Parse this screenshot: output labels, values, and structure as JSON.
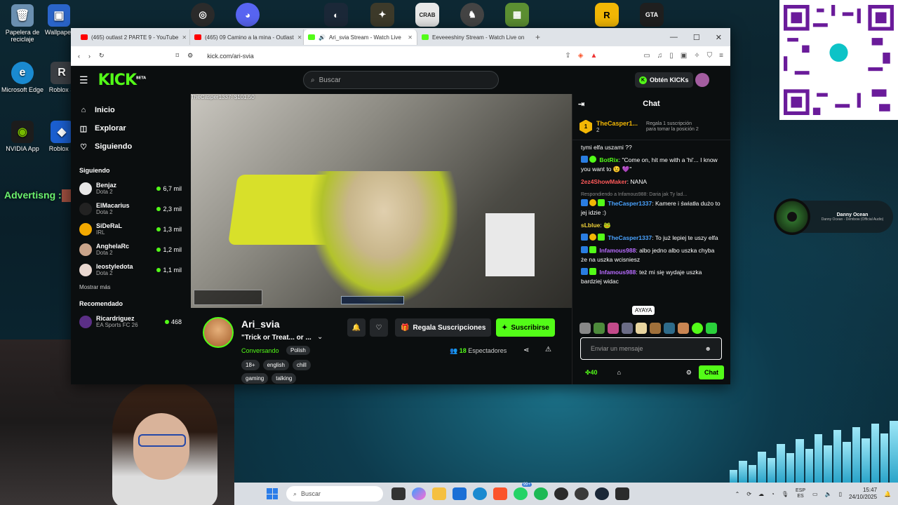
{
  "desktop": {
    "icons": [
      {
        "label": "Papelera de reciclaje",
        "glyph": "🗑",
        "color": "#6a8fb0"
      },
      {
        "label": "Wallpaper",
        "glyph": "▣",
        "color": "#2a64c9"
      },
      {
        "label": "Microsoft Edge",
        "glyph": "e",
        "color": "#1a8ad0"
      },
      {
        "label": "Roblox S",
        "glyph": "R",
        "color": "#3b3f44"
      },
      {
        "label": "NVIDIA App",
        "glyph": "◉",
        "color": "#76b900"
      },
      {
        "label": "Roblox P",
        "glyph": "◆",
        "color": "#1b5fd0"
      }
    ],
    "advertising": "Advertisng :"
  },
  "music": {
    "title": "Danny Ocean",
    "subtitle": "Danny Ocean - Dembow (Official Audio)"
  },
  "browser": {
    "tabs": [
      {
        "label": "(465) outlast 2 PARTE 9 - YouTube",
        "color": "#ff0000"
      },
      {
        "label": "(465) 09 Camino a la mina - Outlast",
        "color": "#ff0000"
      },
      {
        "label": "Ari_svia Stream - Watch Live",
        "color": "#53fc18"
      },
      {
        "label": "Eeveeeshiny Stream - Watch Live on",
        "color": "#53fc18"
      }
    ],
    "url": "kick.com/ari-svia",
    "newtab": "+",
    "min": "—",
    "max": "☐",
    "close": "✕"
  },
  "kick": {
    "logo": "KICK",
    "logo_beta": "BETA",
    "search_placeholder": "Buscar",
    "get_kicks": "Obtén KICKs",
    "nav": [
      {
        "label": "Inicio",
        "icon": "⌂"
      },
      {
        "label": "Explorar",
        "icon": "◫"
      },
      {
        "label": "Siguiendo",
        "icon": "♡"
      }
    ],
    "following_heading": "Siguiendo",
    "following": [
      {
        "name": "Benjaz",
        "category": "Dota 2",
        "viewers": "6,7 mil",
        "color": "#e8e8e8"
      },
      {
        "name": "ElMacarius",
        "category": "Dota 2",
        "viewers": "2,3 mil",
        "color": "#222222"
      },
      {
        "name": "SiDeRaL",
        "category": "IRL",
        "viewers": "1,3 mil",
        "color": "#f2a900"
      },
      {
        "name": "AnghelaRc",
        "category": "Dota 2",
        "viewers": "1,2 mil",
        "color": "#c9a48a"
      },
      {
        "name": "leostyledota",
        "category": "Dota 2",
        "viewers": "1,1 mil",
        "color": "#e9d8d0"
      }
    ],
    "show_more": "Mostrar más",
    "recommended_heading": "Recomendado",
    "recommended": [
      {
        "name": "Ricardriguez",
        "category": "EA Sports FC 26",
        "viewers": "468",
        "color": "#5b2f86"
      }
    ],
    "donor_overlay": "TheCasper1337: $101.50",
    "stream": {
      "name": "Ari_svia",
      "title": "\"Trick or Treat... or ...",
      "category": "Conversando",
      "language": "Polish",
      "tags": [
        "18+",
        "english",
        "chill",
        "gaming",
        "talking"
      ],
      "gift_label": "Regala Suscripciones",
      "subscribe_label": "Suscribirse",
      "viewers_count": "18",
      "viewers_label": "Espectadores"
    },
    "chat": {
      "title": "Chat",
      "pinned": {
        "rank": "1",
        "name": "TheCasper1...",
        "count": "2",
        "gift_text": "Regala 1 suscripción para tomar la posición 2"
      },
      "messages": [
        {
          "user": "",
          "color": "#ffffff",
          "text": "tymi elfa uszami ??",
          "reply": ""
        },
        {
          "user": "BotRix",
          "color": "#53fc18",
          "text": "\"Come on, hit me with a 'hi'... I know you want to 😉 💜\"",
          "reply": ""
        },
        {
          "user": "2ez4ShowMaker",
          "color": "#ff5a5a",
          "text": "NANA",
          "reply": ""
        },
        {
          "user": "TheCasper1337",
          "color": "#4aa3ff",
          "text": "Kamere i światła dużo to jej idzie :)",
          "reply": "Respondiendo a Infamous988: Daria jak Ty lad..."
        },
        {
          "user": "sLblue",
          "color": "#f2d43a",
          "text": "🐸",
          "reply": ""
        },
        {
          "user": "TheCasper1337",
          "color": "#4aa3ff",
          "text": "To już lepiej te uszy elfa",
          "reply": ""
        },
        {
          "user": "Infamous988",
          "color": "#b86cff",
          "text": "albo jedno albo uszka chyba że na uszka wcisniesz",
          "reply": ""
        },
        {
          "user": "Infamous988",
          "color": "#b86cff",
          "text": "też mi się wydaje uszka bardziej widac",
          "reply": ""
        }
      ],
      "tooltip": "AYAYA",
      "input_placeholder": "Enviar un mensaje",
      "points": "40",
      "send_label": "Chat"
    }
  },
  "taskbar": {
    "search": "Buscar",
    "lang_top": "ESP",
    "lang_bottom": "ES",
    "time": "15:47",
    "date": "24/10/2025",
    "badge": "99+"
  }
}
